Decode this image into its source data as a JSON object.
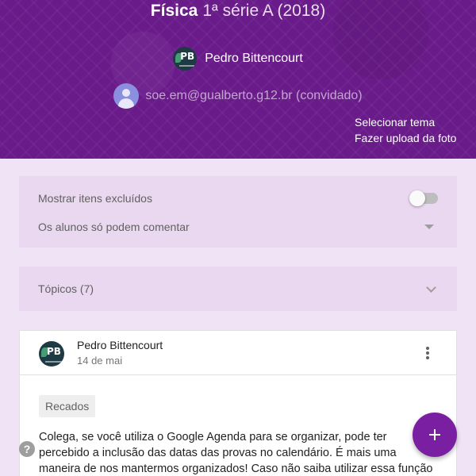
{
  "header": {
    "class_name": "Física",
    "class_section": "1ª série A (2018)",
    "teacher": {
      "name": "Pedro Bittencourt",
      "avatar_initials": "PB"
    },
    "guest": {
      "email_status": "soe.em@gualberto.g12.br (convidado)"
    },
    "links": {
      "select_theme": "Selecionar tema",
      "upload_photo": "Fazer upload da foto"
    }
  },
  "settings": {
    "show_deleted_label": "Mostrar itens excluídos",
    "show_deleted_on": false,
    "comment_permission_value": "Os alunos só podem comentar"
  },
  "topics": {
    "label": "Tópicos (7)"
  },
  "post": {
    "author": "Pedro Bittencourt",
    "author_initials": "PB",
    "date": "14 de mai",
    "topic_chip": "Recados",
    "text": "Colega, se você utiliza o Google Agenda para se organizar, pode ter percebido a inclusão das datas das provas no calendário. É mais uma maneira de nos mantermos organizados! Caso não saiba utilizar essa função ou deseje importar"
  },
  "fab": {
    "symbol": "+"
  },
  "help": {
    "symbol": "?"
  },
  "colors": {
    "banner": "#6a1b8a",
    "page_background": "#f0e3f5",
    "card_tint": "#ead8f0",
    "accent": "#7b1fa2"
  },
  "icons": [
    "pb-avatar-icon",
    "guest-avatar-icon",
    "chevron-down-icon",
    "more-vert-icon",
    "add-icon",
    "help-icon"
  ]
}
